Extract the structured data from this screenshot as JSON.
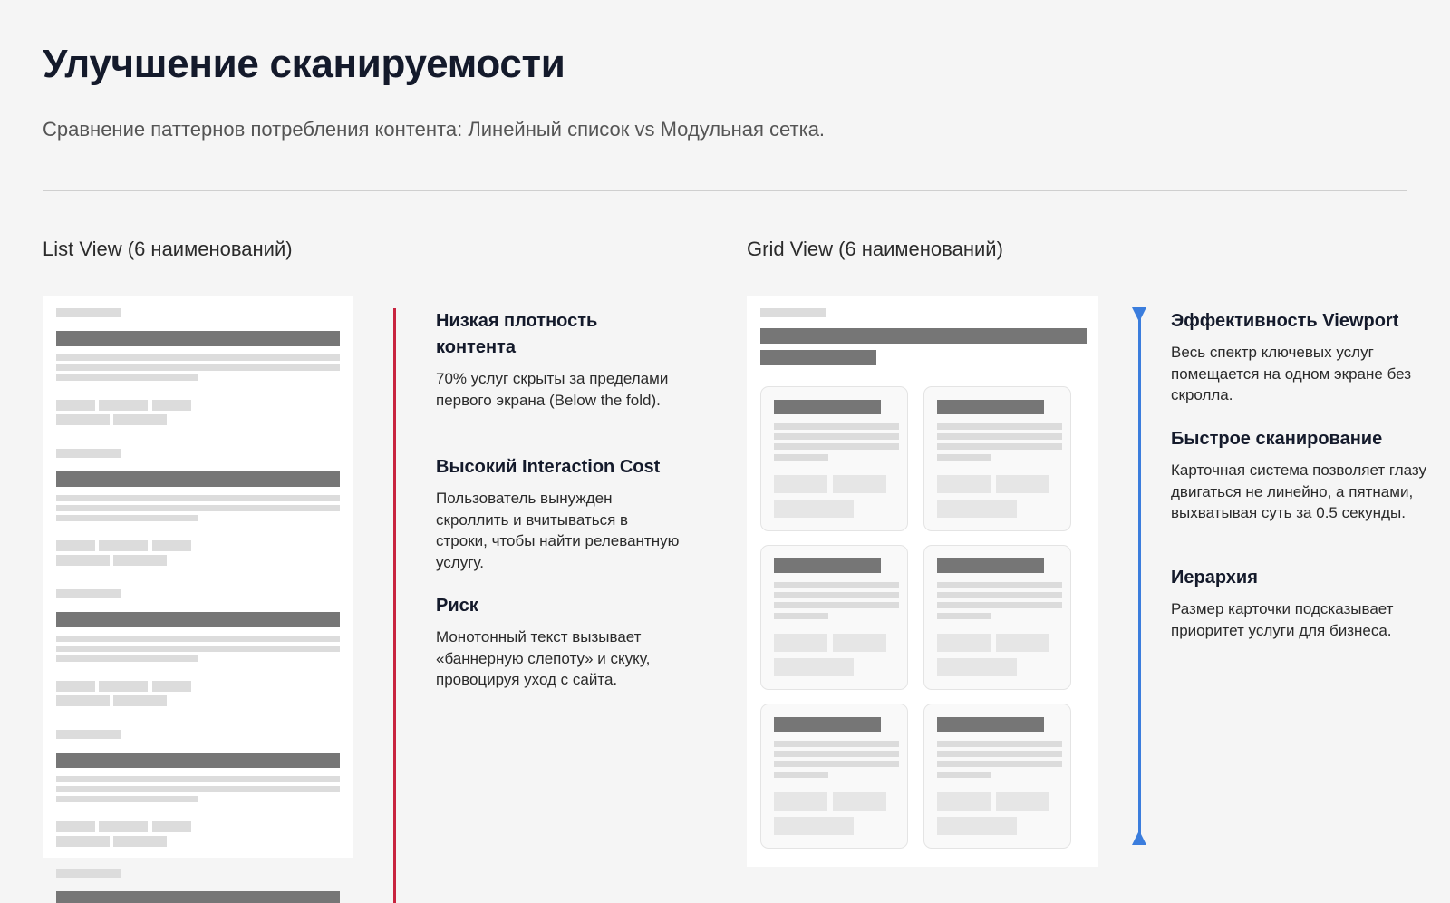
{
  "header": {
    "title": "Улучшение сканируемости",
    "subtitle": "Сравнение паттернов потребления контента: Линейный список vs Модульная сетка."
  },
  "list_view": {
    "title": "List View (6 наименований)",
    "notes": [
      {
        "heading": "Низкая плотность контента",
        "text": "70% услуг скрыты за пределами первого экрана (Below the fold)."
      },
      {
        "heading": "Высокий Interaction Cost",
        "text": "Пользователь вынужден скроллить и вчитываться в строки, чтобы найти релевантную услугу."
      },
      {
        "heading": "Риск",
        "text": "Монотонный текст вызывает «баннерную слепоту» и скуку, провоцируя уход с сайта."
      }
    ]
  },
  "grid_view": {
    "title": "Grid View (6 наименований)",
    "notes": [
      {
        "heading": "Эффективность Viewport",
        "text": "Весь спектр ключевых услуг помещается на одном экране без скролла."
      },
      {
        "heading": "Быстрое сканирование",
        "text": "Карточная система позволяет глазу двигаться не линейно, а пятнами, выхватывая суть за 0.5 секунды."
      },
      {
        "heading": "Иерархия",
        "text": "Размер карточки подсказывает приоритет услуги для бизнеса."
      }
    ]
  },
  "colors": {
    "background": "#f5f5f5",
    "negative_accent": "#c8243f",
    "positive_accent": "#3b7ddd",
    "wireframe_dark": "#767676",
    "wireframe_light": "#dcdcdc"
  }
}
